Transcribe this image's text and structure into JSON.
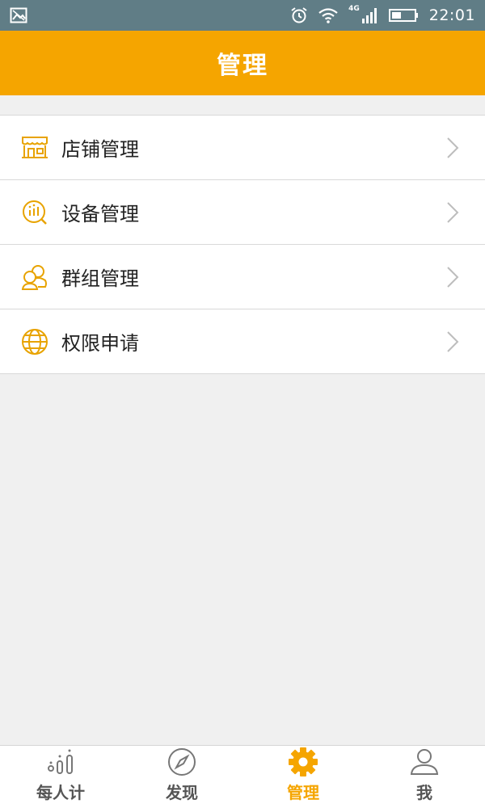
{
  "status_bar": {
    "network": "4G",
    "time": "22:01"
  },
  "header": {
    "title": "管理"
  },
  "menu": [
    {
      "label": "店铺管理",
      "icon": "store-icon"
    },
    {
      "label": "设备管理",
      "icon": "device-icon"
    },
    {
      "label": "群组管理",
      "icon": "group-icon"
    },
    {
      "label": "权限申请",
      "icon": "globe-icon"
    }
  ],
  "tabs": [
    {
      "label": "每人计",
      "icon": "stats-icon",
      "active": false
    },
    {
      "label": "发现",
      "icon": "compass-icon",
      "active": false
    },
    {
      "label": "管理",
      "icon": "gear-icon",
      "active": true
    },
    {
      "label": "我",
      "icon": "user-icon",
      "active": false
    }
  ],
  "colors": {
    "accent": "#f5a500",
    "status_bar": "#607d86",
    "background": "#f0f0f0"
  }
}
